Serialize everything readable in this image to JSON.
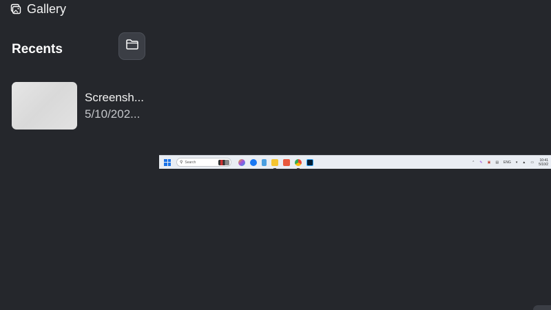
{
  "nav": {
    "gallery_label": "Gallery"
  },
  "recents": {
    "title": "Recents",
    "items": [
      {
        "name": "Screensh...",
        "date": "5/10/202..."
      }
    ]
  },
  "preview": {
    "search_placeholder": "Search",
    "tray": {
      "lang": "ENG",
      "time": "10:41",
      "date": "5/10/2"
    }
  },
  "colors": {
    "background": "#25272c",
    "folder_button": "#3b3e45",
    "taskbar": "#e9edf3"
  }
}
